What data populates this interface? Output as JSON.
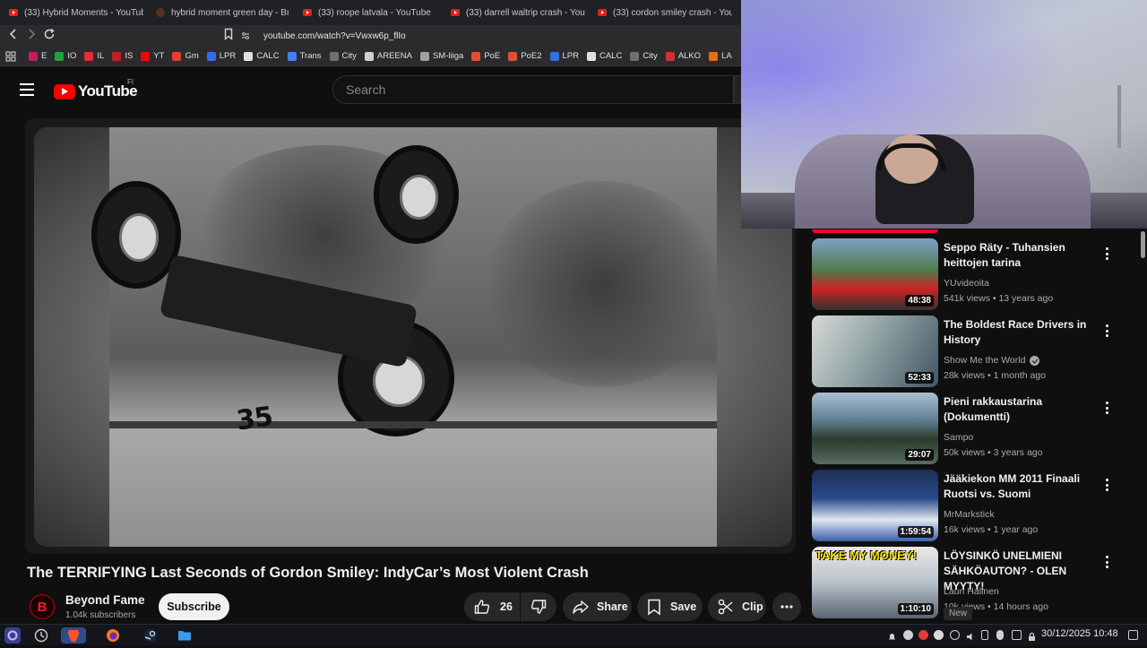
{
  "browser": {
    "tabs": [
      {
        "label": "(33) Hybrid Moments - YouTube",
        "icon": "youtube-icon"
      },
      {
        "label": "hybrid moment green day - Bra",
        "icon": "brave-icon"
      },
      {
        "label": "(33) roope latvala - YouTube",
        "icon": "youtube-icon"
      },
      {
        "label": "(33) darrell waltrip crash - YouTu",
        "icon": "youtube-icon"
      },
      {
        "label": "(33) cordon smiley crash - YouTu",
        "icon": "youtube-icon"
      }
    ],
    "url": "youtube.com/watch?v=Vwxw6p_flIo",
    "bookmarks": [
      {
        "label": "E",
        "color": "#c02060"
      },
      {
        "label": "IO",
        "color": "#20a040"
      },
      {
        "label": "IL",
        "color": "#e03030"
      },
      {
        "label": "IS",
        "color": "#c02020"
      },
      {
        "label": "YT",
        "color": "#ff0000"
      },
      {
        "label": "Gm",
        "color": "#e04030"
      },
      {
        "label": "LPR",
        "color": "#3070e0"
      },
      {
        "label": "CALC",
        "color": "#e0e0e0"
      },
      {
        "label": "Trans",
        "color": "#4080f0"
      },
      {
        "label": "City",
        "color": "#707070"
      },
      {
        "label": "AREENA",
        "color": "#d0d0d0"
      },
      {
        "label": "SM-liiga",
        "color": "#a0a0a0"
      },
      {
        "label": "PoE",
        "color": "#e05030"
      },
      {
        "label": "PoE2",
        "color": "#e05030"
      },
      {
        "label": "LPR",
        "color": "#3070e0"
      },
      {
        "label": "CALC",
        "color": "#e0e0e0"
      },
      {
        "label": "City",
        "color": "#707070"
      },
      {
        "label": "ALKO",
        "color": "#d03030"
      },
      {
        "label": "LA",
        "color": "#e07020"
      }
    ]
  },
  "youtube": {
    "logo_text": "YouTube",
    "region": "FI",
    "search_placeholder": "Search"
  },
  "video": {
    "car_number": "35",
    "title": "The TERRIFYING Last Seconds of Gordon Smiley: IndyCar’s Most Violent Crash",
    "channel": {
      "name": "Beyond Fame",
      "subscribers": "1.04k subscribers",
      "avatar_letter": "B"
    },
    "subscribe_label": "Subscribe",
    "likes": "26",
    "share_label": "Share",
    "save_label": "Save",
    "clip_label": "Clip"
  },
  "recommendations": [
    {
      "title": "Seppo Räty - Tuhansien heittojen tarina",
      "channel": "YUvideoita",
      "verified": false,
      "meta": "541k views • 13 years ago",
      "duration": "48:38"
    },
    {
      "title": "The Boldest Race Drivers in History",
      "channel": "Show Me the World",
      "verified": true,
      "meta": "28k views • 1 month ago",
      "duration": "52:33"
    },
    {
      "title": "Pieni rakkaustarina (Dokumentti)",
      "channel": "Sampo",
      "verified": false,
      "meta": "50k views • 3 years ago",
      "duration": "29:07"
    },
    {
      "title": "Jääkiekon MM 2011 Finaali Ruotsi vs. Suomi",
      "channel": "MrMarkstick",
      "verified": false,
      "meta": "16k views • 1 year ago",
      "duration": "1:59:54"
    },
    {
      "title": "LÖYSINKÖ UNELMIENI SÄHKÖAUTON? - OLEN MYYTY!",
      "channel": "Lauri Halinen",
      "verified": false,
      "meta": "10k views • 14 hours ago",
      "duration": "1:10:10",
      "thumb_text": "TAKE MY MONEY!",
      "badge": "New"
    }
  ],
  "taskbar": {
    "clock": "30/12/2025 10:48"
  },
  "colors": {
    "accent": "#ff0000",
    "background": "#0f0f0f",
    "pill": "#272727"
  }
}
